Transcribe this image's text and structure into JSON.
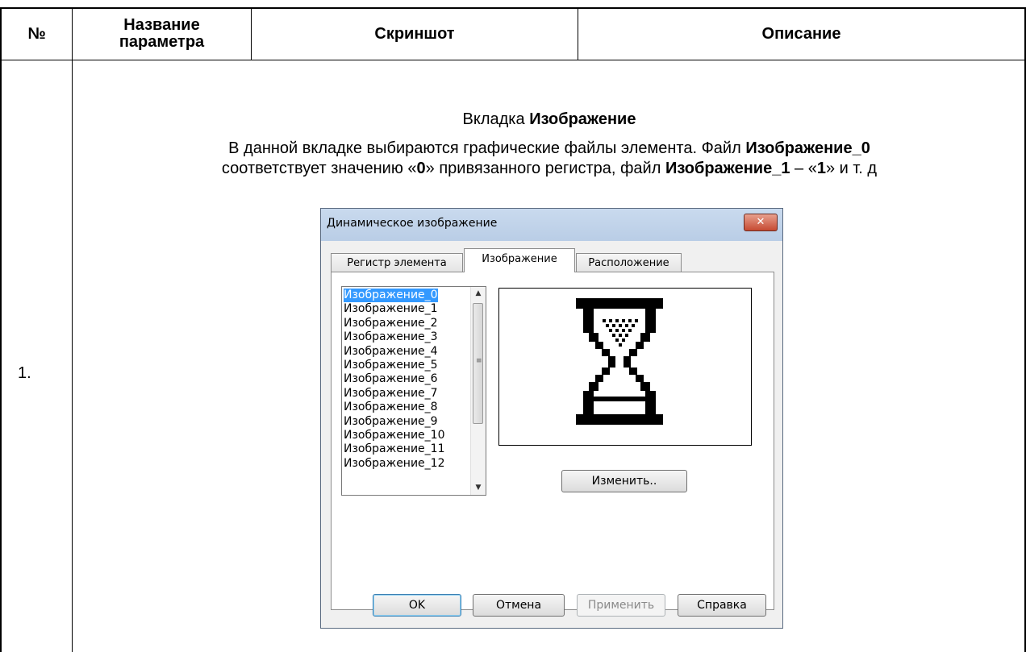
{
  "table": {
    "headers": {
      "num": "№",
      "name_line1": "Название",
      "name_line2": "параметра",
      "screenshot": "Скриншот",
      "description": "Описание"
    },
    "row": {
      "number": "1.",
      "section_prefix": "Вкладка ",
      "section_bold": "Изображение",
      "line1_text": "В данной вкладке выбираются графические файлы элемента. Файл ",
      "line1_bold": "Изображение_0",
      "line2_a": "соответствует значению «",
      "line2_b": "0",
      "line2_c": "» привязанного регистра, файл ",
      "line2_d": "Изображение_1",
      "line2_e": " – «",
      "line2_f": "1",
      "line2_g": "» и т. д"
    }
  },
  "dialog": {
    "title": "Динамическое изображение",
    "close_glyph": "✕",
    "tabs": [
      {
        "label": "Регистр элемента",
        "active": false
      },
      {
        "label": "Изображение",
        "active": true
      },
      {
        "label": "Расположение",
        "active": false
      }
    ],
    "list_items": [
      "Изображение_0",
      "Изображение_1",
      "Изображение_2",
      "Изображение_3",
      "Изображение_4",
      "Изображение_5",
      "Изображение_6",
      "Изображение_7",
      "Изображение_8",
      "Изображение_9",
      "Изображение_10",
      "Изображение_11",
      "Изображение_12"
    ],
    "selected_index": 0,
    "preview_icon": "hourglass-icon",
    "change_button": "Изменить..",
    "buttons": {
      "ok": "OK",
      "cancel": "Отмена",
      "apply": "Применить",
      "help": "Справка"
    }
  }
}
